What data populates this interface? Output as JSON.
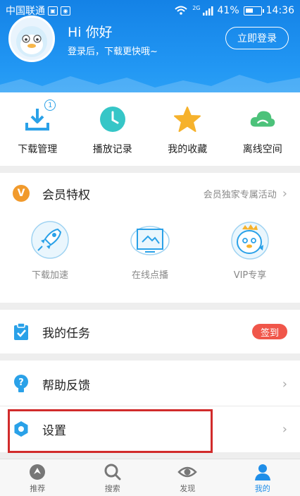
{
  "status_bar": {
    "carrier": "中国联通",
    "network": "2G",
    "battery": "41%",
    "time": "14:36"
  },
  "profile": {
    "greeting": "Hi 你好",
    "subtitle": "登录后，下载更快哦~",
    "login_label": "立即登录"
  },
  "quick_actions": [
    {
      "label": "下载管理",
      "icon": "download-icon",
      "badge": "1"
    },
    {
      "label": "播放记录",
      "icon": "clock-icon"
    },
    {
      "label": "我的收藏",
      "icon": "star-icon"
    },
    {
      "label": "离线空间",
      "icon": "cloud-icon"
    }
  ],
  "vip": {
    "title": "会员特权",
    "link": "会员独家专属活动",
    "mark": "V",
    "items": [
      {
        "label": "下载加速",
        "icon": "rocket-icon"
      },
      {
        "label": "在线点播",
        "icon": "screen-icon"
      },
      {
        "label": "VIP专享",
        "icon": "vip-mascot-icon"
      }
    ]
  },
  "tasks": {
    "title": "我的任务",
    "sign_label": "签到"
  },
  "help": {
    "title": "帮助反馈"
  },
  "settings": {
    "title": "设置"
  },
  "tabbar": [
    {
      "label": "推荐",
      "icon": "recommend-icon",
      "active": false
    },
    {
      "label": "搜索",
      "icon": "search-icon",
      "active": false
    },
    {
      "label": "发现",
      "icon": "eye-icon",
      "active": false
    },
    {
      "label": "我的",
      "icon": "user-icon",
      "active": true
    }
  ],
  "colors": {
    "header_blue": "#1e90ee",
    "accent_blue": "#2aa1e8",
    "vip_orange": "#f19a2c",
    "sign_red": "#f0564a",
    "highlight_red": "#d12b2b"
  }
}
